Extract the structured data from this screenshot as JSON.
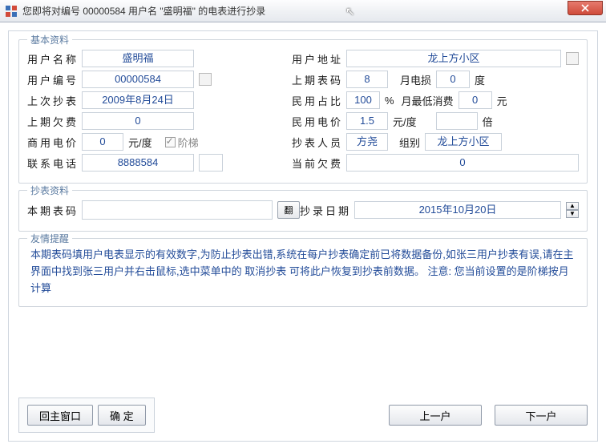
{
  "window": {
    "title": "您即将对编号 00000584 用户名 \"盛明福\" 的电表进行抄录"
  },
  "groups": {
    "basic": "基本资料",
    "reading": "抄表资料",
    "tip": "友情提醒"
  },
  "basic": {
    "username_label": "用户名称",
    "username": "盛明福",
    "address_label": "用户地址",
    "address": "龙上方小区",
    "userno_label": "用户编号",
    "userno": "00000584",
    "prev_code_label": "上期表码",
    "prev_code": "8",
    "month_loss_label": "月电损",
    "month_loss": "0",
    "month_loss_unit": "度",
    "last_read_label": "上次抄表",
    "last_read": "2009年8月24日",
    "civil_ratio_label": "民用占比",
    "civil_ratio": "100",
    "civil_ratio_unit": "%",
    "min_consume_label": "月最低消费",
    "min_consume": "0",
    "min_consume_unit": "元",
    "prev_arrears_label": "上期欠费",
    "prev_arrears": "0",
    "civil_price_label": "民用电价",
    "civil_price": "1.5",
    "civil_price_unit": "元/度",
    "multiplier_unit": "倍",
    "biz_price_label": "商用电价",
    "biz_price": "0",
    "biz_price_unit": "元/度",
    "ladder_label": "阶梯",
    "reader_label": "抄表人员",
    "reader": "方尧",
    "group_label": "组别",
    "group": "龙上方小区",
    "phone_label": "联系电话",
    "phone": "8888584",
    "cur_arrears_label": "当前欠费",
    "cur_arrears": "0"
  },
  "reading": {
    "cur_code_label": "本期表码",
    "cur_code": "",
    "flip_btn": "翻",
    "date_label": "抄录日期",
    "date": "2015年10月20日"
  },
  "tip": {
    "text": "本期表码填用户电表显示的有效数字,为防止抄表出错,系统在每户抄表确定前已将数据备份,如张三用户抄表有误,请在主界面中找到张三用户并右击鼠标,选中菜单中的 取消抄表 可将此户恢复到抄表前数据。  注意:  您当前设置的是阶梯按月计算"
  },
  "buttons": {
    "back": "回主窗口",
    "ok": "确  定",
    "prev": "上一户",
    "next": "下一户"
  }
}
